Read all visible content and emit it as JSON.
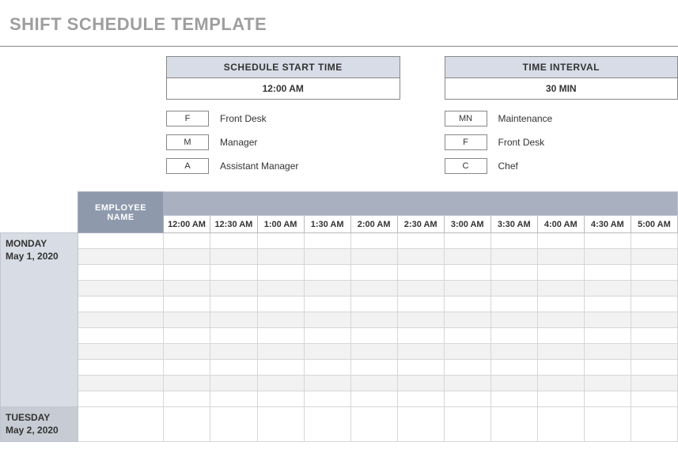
{
  "title": "SHIFT SCHEDULE TEMPLATE",
  "config": {
    "start_label": "SCHEDULE START TIME",
    "start_value": "12:00 AM",
    "interval_label": "TIME INTERVAL",
    "interval_value": "30 MIN"
  },
  "legend": {
    "left": [
      {
        "code": "F",
        "label": "Front Desk"
      },
      {
        "code": "M",
        "label": "Manager"
      },
      {
        "code": "A",
        "label": "Assistant Manager"
      }
    ],
    "right": [
      {
        "code": "MN",
        "label": "Maintenance"
      },
      {
        "code": "F",
        "label": "Front Desk"
      },
      {
        "code": "C",
        "label": "Chef"
      }
    ]
  },
  "grid": {
    "employee_header": "EMPLOYEE NAME",
    "times": [
      "12:00 AM",
      "12:30 AM",
      "1:00 AM",
      "1:30 AM",
      "2:00 AM",
      "2:30 AM",
      "3:00 AM",
      "3:30 AM",
      "4:00 AM",
      "4:30 AM",
      "5:00 AM"
    ],
    "days": [
      {
        "name": "MONDAY",
        "date": "May 1, 2020",
        "rows": 11
      },
      {
        "name": "TUESDAY",
        "date": "May 2, 2020",
        "rows": 1
      }
    ]
  }
}
